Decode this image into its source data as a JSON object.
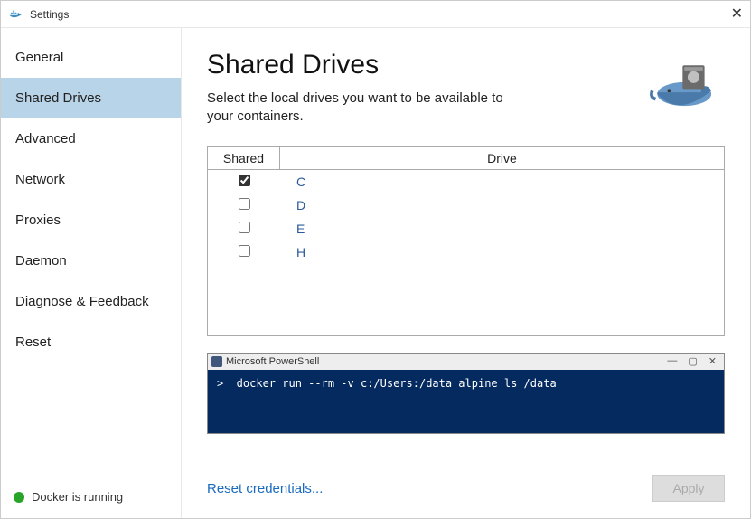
{
  "window": {
    "title": "Settings",
    "close_glyph": "✕"
  },
  "sidebar": {
    "items": [
      {
        "label": "General",
        "selected": false
      },
      {
        "label": "Shared Drives",
        "selected": true
      },
      {
        "label": "Advanced",
        "selected": false
      },
      {
        "label": "Network",
        "selected": false
      },
      {
        "label": "Proxies",
        "selected": false
      },
      {
        "label": "Daemon",
        "selected": false
      },
      {
        "label": "Diagnose & Feedback",
        "selected": false
      },
      {
        "label": "Reset",
        "selected": false
      }
    ],
    "status_text": "Docker is running",
    "status_color": "#28a528"
  },
  "main": {
    "heading": "Shared Drives",
    "description": "Select the local drives you want to be available to your containers.",
    "table": {
      "headers": {
        "shared": "Shared",
        "drive": "Drive"
      },
      "rows": [
        {
          "shared": true,
          "drive": "C"
        },
        {
          "shared": false,
          "drive": "D"
        },
        {
          "shared": false,
          "drive": "E"
        },
        {
          "shared": false,
          "drive": "H"
        }
      ]
    },
    "powershell": {
      "title": "Microsoft PowerShell",
      "command": ">  docker run --rm -v c:/Users:/data alpine ls /data",
      "minimize_glyph": "—",
      "maximize_glyph": "▢",
      "close_glyph": "✕"
    },
    "reset_link": "Reset credentials...",
    "apply_label": "Apply"
  }
}
